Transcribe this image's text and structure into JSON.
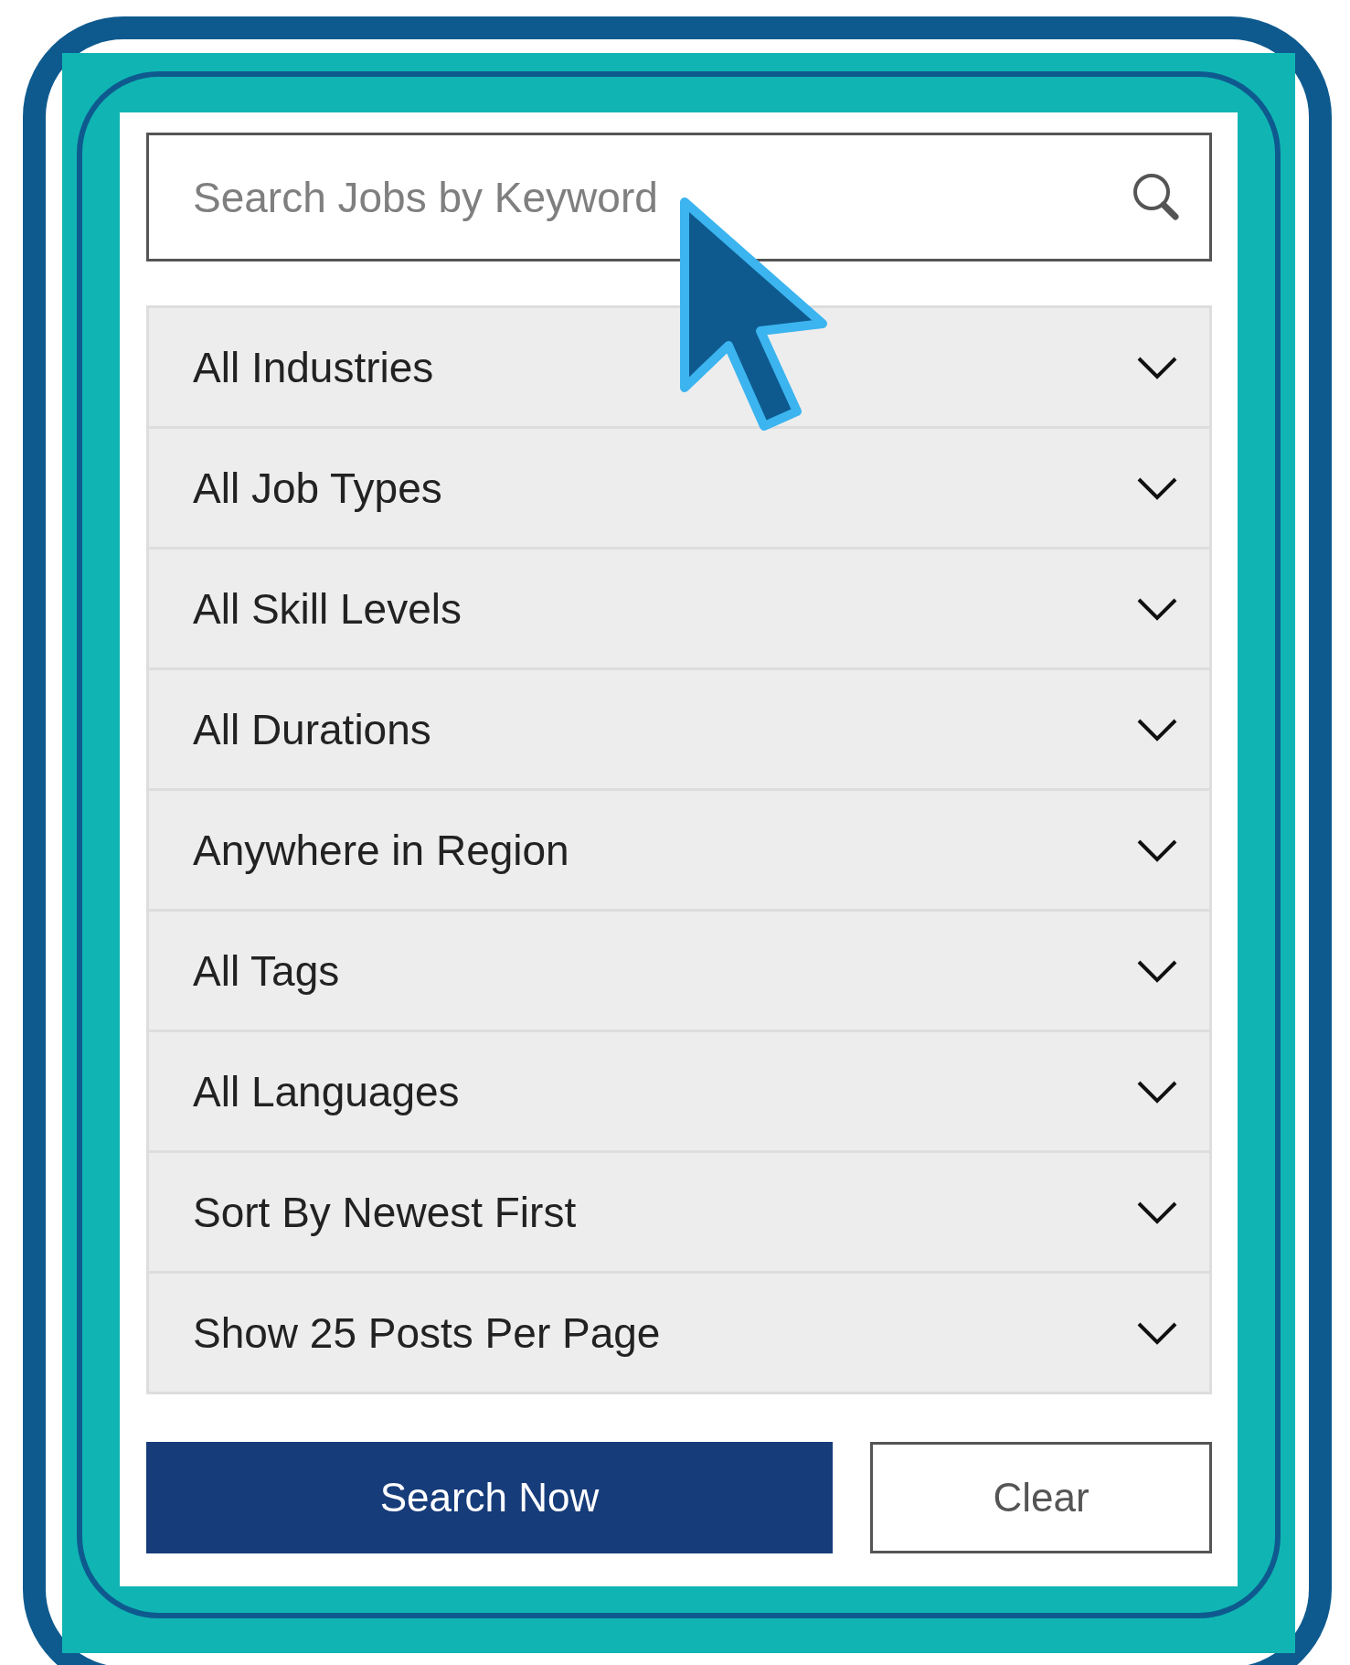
{
  "search": {
    "placeholder": "Search Jobs by Keyword"
  },
  "filters": [
    {
      "label": "All Industries"
    },
    {
      "label": "All Job Types"
    },
    {
      "label": "All Skill Levels"
    },
    {
      "label": "All Durations"
    },
    {
      "label": "Anywhere in Region"
    },
    {
      "label": "All Tags"
    },
    {
      "label": "All Languages"
    },
    {
      "label": "Sort By Newest First"
    },
    {
      "label": "Show 25 Posts Per Page"
    }
  ],
  "buttons": [
    {
      "label": "Search Now",
      "kind": "primary"
    },
    {
      "label": "Clear",
      "kind": "secondary"
    }
  ]
}
